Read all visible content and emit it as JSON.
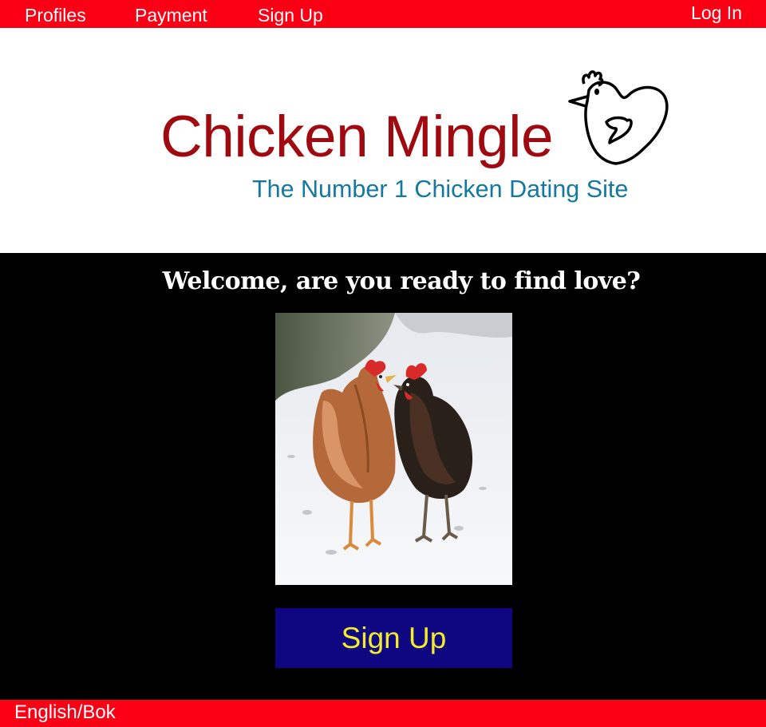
{
  "nav": {
    "profiles": "Profiles",
    "payment": "Payment",
    "signup": "Sign Up",
    "login": "Log In"
  },
  "header": {
    "title": "Chicken Mingle",
    "tagline": "The Number 1 Chicken Dating Site",
    "logo_icon": "chicken-heart-icon"
  },
  "main": {
    "welcome": "Welcome, are you ready to find love?",
    "photo_icon": "two-chickens-in-snow-photo",
    "signup_button": "Sign Up"
  },
  "footer": {
    "language": "English/Bok"
  },
  "colors": {
    "nav_bar": "#fb0014",
    "title": "#a0090f",
    "tagline": "#1478a0",
    "button_bg": "#0f0781",
    "button_text": "#f2ec2a"
  }
}
